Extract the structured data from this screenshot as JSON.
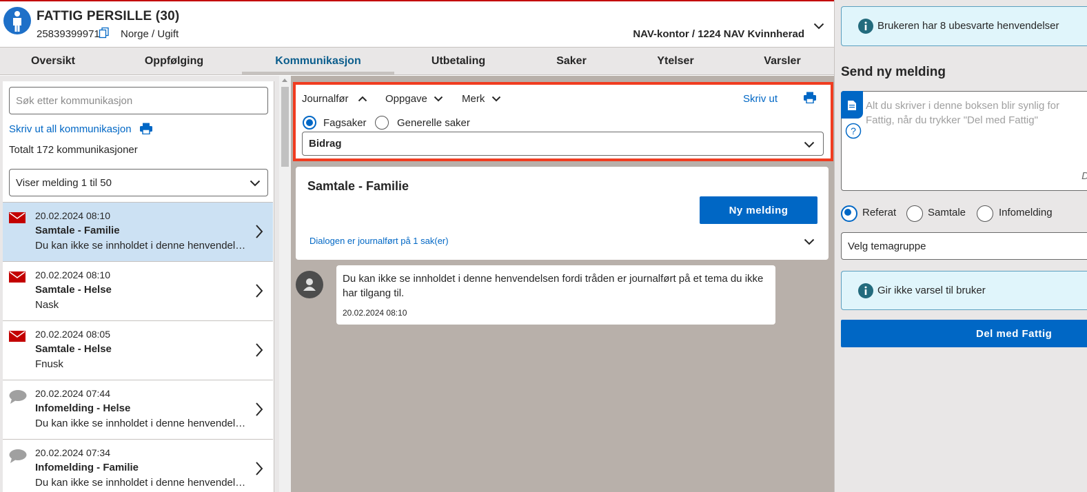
{
  "colors": {
    "accent": "#0067c5",
    "highlight_border": "#f03c20",
    "selected_row": "#cce1f3",
    "unread_icon": "#c30000",
    "center_bg": "#b8b0aa"
  },
  "person": {
    "name": "FATTIG PERSILLE (30)",
    "fnr": "25839399971",
    "nationality": "Norge / Ugift",
    "nav_office": "NAV-kontor / 1224 NAV Kvinnherad"
  },
  "tabs": [
    "Oversikt",
    "Oppfølging",
    "Kommunikasjon",
    "Utbetaling",
    "Saker",
    "Ytelser",
    "Varsler"
  ],
  "active_tab": "Kommunikasjon",
  "left": {
    "search_placeholder": "Søk etter kommunikasjon",
    "print_all": "Skriv ut all kommunikasjon",
    "total": "Totalt 172 kommunikasjoner",
    "range_select": "Viser melding 1 til 50",
    "messages": [
      {
        "icon": "envelope-icon",
        "date": "20.02.2024 08:10",
        "title": "Samtale - Familie",
        "preview": "Du kan ikke se innholdet i denne henvendelsen fordi tråden er journalført",
        "selected": true
      },
      {
        "icon": "envelope-icon",
        "date": "20.02.2024 08:10",
        "title": "Samtale - Helse",
        "preview": "Nask",
        "selected": false
      },
      {
        "icon": "envelope-icon",
        "date": "20.02.2024 08:05",
        "title": "Samtale - Helse",
        "preview": "Fnusk",
        "selected": false
      },
      {
        "icon": "speech-bubble-icon",
        "date": "20.02.2024 07:44",
        "title": "Infomelding - Helse",
        "preview": "Du kan ikke se innholdet i denne henvendelsen fordi tråden er journalført",
        "selected": false
      },
      {
        "icon": "speech-bubble-icon",
        "date": "20.02.2024 07:34",
        "title": "Infomelding - Familie",
        "preview": "Du kan ikke se innholdet i denne henvendelsen fordi tråden er journalført",
        "selected": false
      }
    ]
  },
  "toolbar": {
    "journalfor": "Journalfør",
    "oppgave": "Oppgave",
    "merk": "Merk",
    "print": "Skriv ut",
    "radio_fagsaker": "Fagsaker",
    "radio_generelle": "Generelle saker",
    "selected_radio": "Fagsaker",
    "sak_select": "Bidrag"
  },
  "dialog": {
    "title": "Samtale - Familie",
    "new_message_button": "Ny melding",
    "journal_text": "Dialogen er journalført på 1 sak(er)",
    "message_text": "Du kan ikke se innholdet i denne henvendelsen fordi tråden er journalført på et tema du ikke har tilgang til.",
    "message_date": "20.02.2024 08:10"
  },
  "right": {
    "unanswered_alert": "Brukeren har 8 ubesvarte henvendelser",
    "send_heading": "Send ny melding",
    "textarea_placeholder": "Alt du skriver i denne boksen blir synlig for Fattig, når du trykker \"Del med Fattig\"",
    "textarea_corner": "D",
    "radio_referat": "Referat",
    "radio_samtale": "Samtale",
    "radio_infomelding": "Infomelding",
    "selected_radio": "Referat",
    "tema_select": "Velg temagruppe",
    "notify_alert": "Gir ikke varsel til bruker",
    "share_button": "Del med Fattig"
  }
}
